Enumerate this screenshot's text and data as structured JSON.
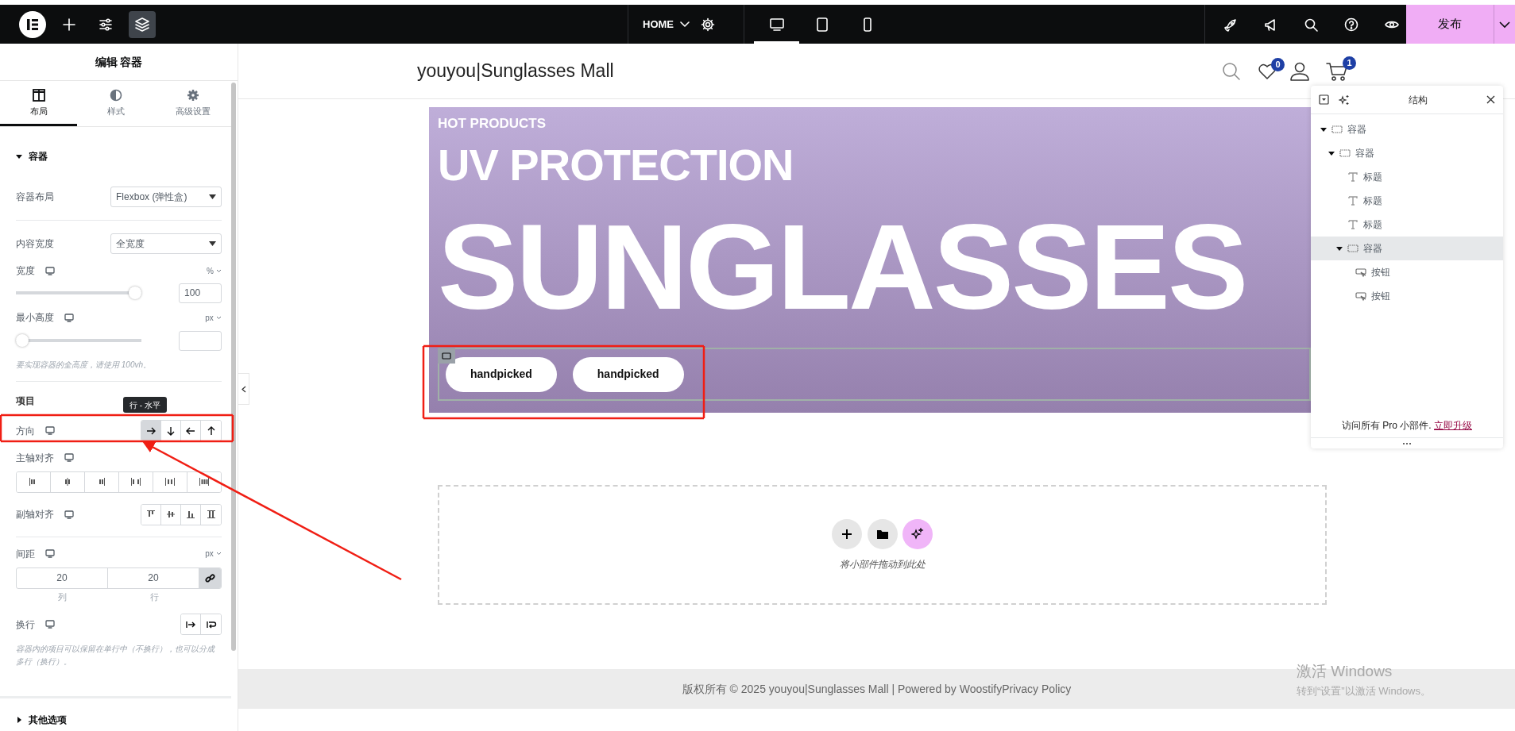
{
  "top_bar": {
    "tools": [
      {
        "kind": "add",
        "selected": false
      },
      {
        "kind": "sliders",
        "selected": false
      },
      {
        "kind": "layers",
        "selected": true
      }
    ],
    "page_menu": {
      "label": "HOME"
    },
    "devices": [
      {
        "kind": "desktop",
        "selected": true
      },
      {
        "kind": "tablet",
        "selected": false
      },
      {
        "kind": "mobile",
        "selected": false
      }
    ],
    "actions": [
      {
        "kind": "rocket"
      },
      {
        "kind": "megaphone"
      },
      {
        "kind": "search"
      },
      {
        "kind": "help"
      },
      {
        "kind": "preview"
      }
    ],
    "publish": "发布"
  },
  "panel": {
    "title": "编辑 容器",
    "tabs": [
      {
        "label": "布局",
        "kind": "layout",
        "selected": true
      },
      {
        "label": "样式",
        "kind": "style",
        "selected": false
      },
      {
        "label": "高级设置",
        "kind": "advanced",
        "selected": false
      }
    ],
    "section": {
      "title": "容器",
      "expanded": true
    },
    "container_layout": {
      "label": "容器布局",
      "value": "Flexbox (弹性盒)"
    },
    "content_width": {
      "label": "内容宽度",
      "value": "全宽度"
    },
    "width": {
      "label": "宽度",
      "unit": "%",
      "level": 1,
      "value": "100"
    },
    "min_height": {
      "label": "最小高度",
      "unit": "px",
      "level": 0
    },
    "min_height_hint": "要实现容器的全高度，请使用 100vh。",
    "items_heading": "项目",
    "direction": {
      "label": "方向",
      "tooltip": "行 - 水平",
      "options": [
        {
          "kind": "right",
          "selected": true
        },
        {
          "kind": "down",
          "selected": false
        },
        {
          "kind": "left",
          "selected": false
        },
        {
          "kind": "up",
          "selected": false
        }
      ]
    },
    "justify": {
      "label": "主轴对齐",
      "options": [
        {
          "kind": "start",
          "selected": false
        },
        {
          "kind": "center",
          "selected": false
        },
        {
          "kind": "end",
          "selected": false
        },
        {
          "kind": "between",
          "selected": false
        },
        {
          "kind": "around",
          "selected": false
        },
        {
          "kind": "evenly",
          "selected": false
        }
      ]
    },
    "align": {
      "label": "副轴对齐",
      "options": [
        {
          "kind": "top",
          "selected": false
        },
        {
          "kind": "middle",
          "selected": false
        },
        {
          "kind": "bottom",
          "selected": false
        },
        {
          "kind": "stretch",
          "selected": false
        }
      ]
    },
    "gap": {
      "label": "间距",
      "unit": "px",
      "column": "20",
      "row": "20",
      "column_label": "列",
      "row_label": "行",
      "linked": true
    },
    "wrap": {
      "label": "换行",
      "options": [
        {
          "kind": "nowrap",
          "selected": false
        },
        {
          "kind": "wrap",
          "selected": false
        }
      ],
      "hint": "容器内的项目可以保留在单行中（不换行），也可以分成多行（换行）。"
    },
    "other_section": {
      "title": "其他选项",
      "expanded": false
    }
  },
  "site": {
    "title": "youyou|Sunglasses Mall",
    "wishlist_count": "0",
    "cart_count": "1"
  },
  "hero": {
    "eyebrow": "HOT PRODUCTS",
    "title": "UV PROTECTION",
    "headline": "SUNGLASSES",
    "buttons": [
      "handpicked",
      "handpicked"
    ]
  },
  "drop_zone": {
    "hint": "将小部件拖动到此处"
  },
  "footer": {
    "text": "版权所有 © 2025 youyou|Sunglasses Mall | Powered by WoostifyPrivacy Policy"
  },
  "structure": {
    "title": "结构",
    "tree": [
      {
        "label": "容器",
        "kind": "container",
        "expanded": true,
        "selected": false,
        "children": [
          {
            "label": "容器",
            "kind": "container",
            "expanded": true,
            "selected": false,
            "children": [
              {
                "label": "标题",
                "kind": "heading",
                "selected": false
              },
              {
                "label": "标题",
                "kind": "heading",
                "selected": false
              },
              {
                "label": "标题",
                "kind": "heading",
                "selected": false
              },
              {
                "label": "容器",
                "kind": "container",
                "expanded": true,
                "selected": true,
                "children": [
                  {
                    "label": "按钮",
                    "kind": "button",
                    "selected": false
                  },
                  {
                    "label": "按钮",
                    "kind": "button",
                    "selected": false
                  }
                ]
              }
            ]
          }
        ]
      }
    ],
    "promo_text": "访问所有 Pro 小部件.",
    "promo_link": "立即升级"
  },
  "os_notice": {
    "title": "激活 Windows",
    "text": "转到“设置”以激活 Windows。"
  }
}
